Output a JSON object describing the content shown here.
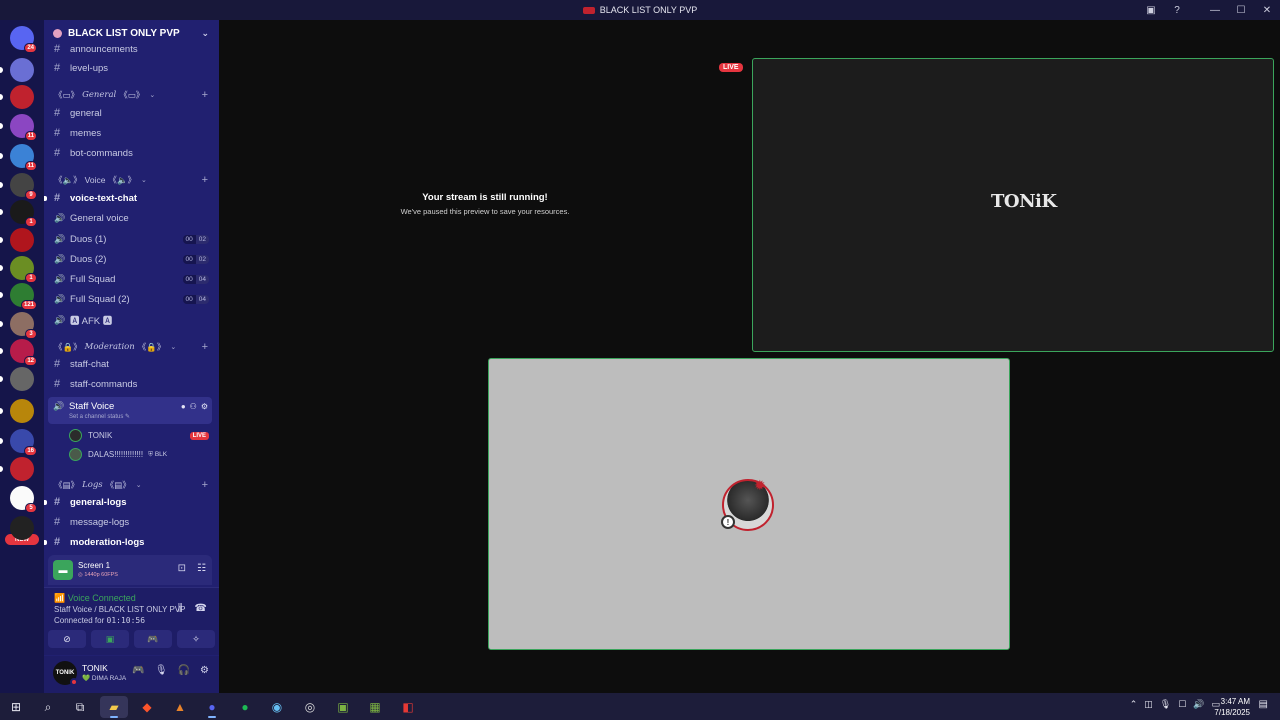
{
  "window": {
    "title": "BLACK LIST ONLY PVP",
    "brand_color": "#c0222e"
  },
  "rail": {
    "servers": [
      {
        "name": "Direct Messages",
        "badge": "24",
        "color": "#5865f2"
      },
      {
        "name": "server-2",
        "badge": "",
        "color": "#6a6fd4"
      },
      {
        "name": "server-3",
        "badge": "",
        "color": "#c0222e"
      },
      {
        "name": "server-4",
        "badge": "11",
        "color": "#8b46c2"
      },
      {
        "name": "server-5",
        "badge": "11",
        "color": "#3b82d6"
      },
      {
        "name": "server-6",
        "badge": "9",
        "color": "#444"
      },
      {
        "name": "server-7",
        "badge": "1",
        "color": "#1a1a1a"
      },
      {
        "name": "server-8",
        "badge": "",
        "color": "#b0151d"
      },
      {
        "name": "server-9",
        "badge": "1",
        "color": "#6b8e23"
      },
      {
        "name": "server-10",
        "badge": "121",
        "color": "#2e7d32"
      },
      {
        "name": "server-11",
        "badge": "3",
        "color": "#8d6e63"
      },
      {
        "name": "server-12",
        "badge": "12",
        "color": "#b71c4a"
      },
      {
        "name": "server-13",
        "badge": "",
        "color": "#666"
      },
      {
        "name": "server-14",
        "badge": "",
        "color": "#b8860b"
      },
      {
        "name": "server-15",
        "badge": "16",
        "color": "#3949ab"
      },
      {
        "name": "server-16",
        "badge": "",
        "color": "#c0222e"
      },
      {
        "name": "server-17",
        "badge": "5",
        "color": "#fafafa"
      },
      {
        "name": "server-18",
        "badge": "",
        "color": "#222"
      }
    ],
    "new_label": "NEW"
  },
  "sidebar": {
    "server_name": "BLACK LIST ONLY PVP",
    "channels_top": [
      {
        "name": "announcements"
      },
      {
        "name": "level-ups"
      }
    ],
    "cat_general": "《💬》𝓖𝓮𝓷𝓮𝓻𝓪𝓵《💬》",
    "cat_general_text": "General",
    "general_channels": [
      {
        "name": "general"
      },
      {
        "name": "memes"
      },
      {
        "name": "bot-commands"
      }
    ],
    "cat_voice": "Voice",
    "voice_text_chat": "voice-text-chat",
    "voice_channels": [
      {
        "name": "General voice",
        "count": "",
        "limit": ""
      },
      {
        "name": "Duos (1)",
        "count": "00",
        "limit": "02"
      },
      {
        "name": "Duos (2)",
        "count": "00",
        "limit": "02"
      },
      {
        "name": "Full Squad",
        "count": "00",
        "limit": "04"
      },
      {
        "name": "Full Squad (2)",
        "count": "00",
        "limit": "04"
      },
      {
        "name": "🅰 AFK 🅰",
        "count": "",
        "limit": ""
      }
    ],
    "cat_moderation": "Moderation",
    "moderation_channels": [
      {
        "name": "staff-chat"
      },
      {
        "name": "staff-commands"
      }
    ],
    "staff_voice": {
      "name": "Staff Voice",
      "status": "Set a channel status ✎"
    },
    "voice_users": [
      {
        "name": "TONIK",
        "live": "LIVE",
        "tag": ""
      },
      {
        "name": "DALAS!!!!!!!!!!!!!",
        "live": "",
        "tag": "⛨ BLK"
      }
    ],
    "cat_logs": "Logs",
    "logs_channels": [
      {
        "name": "general-logs",
        "bold": true
      },
      {
        "name": "message-logs",
        "bold": false
      },
      {
        "name": "moderation-logs",
        "bold": true
      }
    ]
  },
  "screen_share": {
    "name": "Screen 1",
    "quality": "◎ 1440p 60FPS"
  },
  "voice_connected": {
    "status": "Voice Connected",
    "location": "Staff Voice / BLACK LIST ONLY PVP",
    "connected_label": "Connected for",
    "duration": "01:10:56"
  },
  "user": {
    "name": "TONIK",
    "custom_status": "💚 DIMA RAJA",
    "avatar_text": "TONIK"
  },
  "main": {
    "paused_title": "Your stream is still running!",
    "paused_body": "We've paused this preview to save your resources.",
    "live_tag": "LIVE",
    "stream_brand": "TONiK",
    "tile_accent": "#3ba55c"
  },
  "taskbar": {
    "time": "3:47 AM",
    "date": "7/18/2025"
  }
}
